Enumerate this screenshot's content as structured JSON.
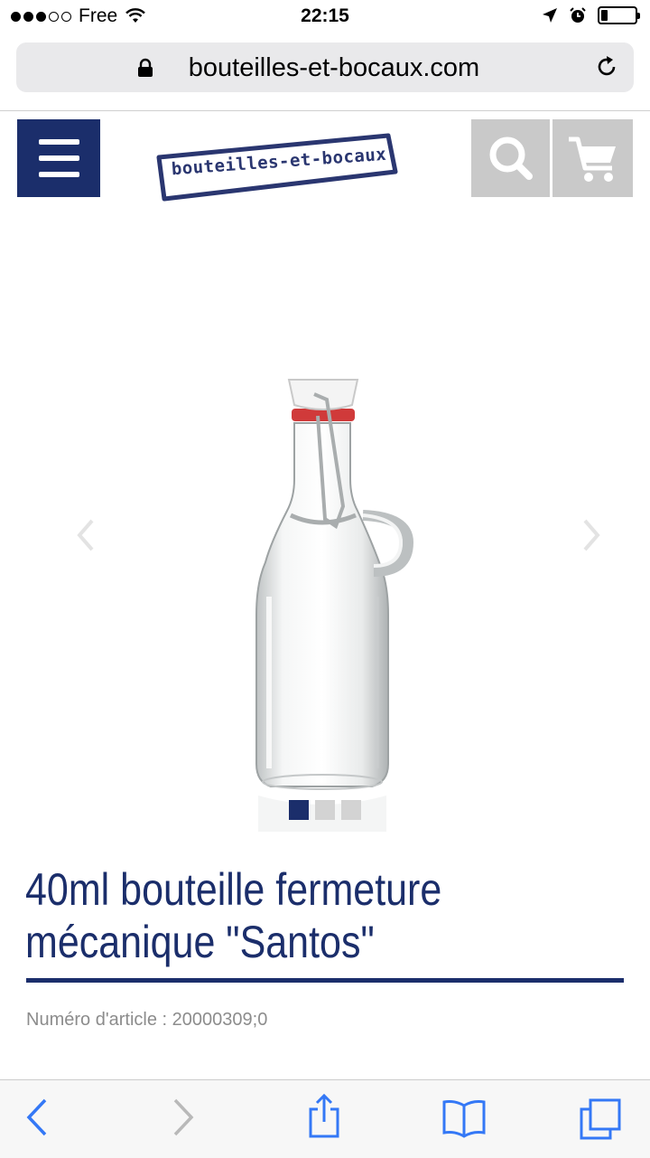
{
  "status_bar": {
    "carrier": "Free",
    "time": "22:15"
  },
  "browser": {
    "url": "bouteilles-et-bocaux.com"
  },
  "site": {
    "logo_text": "bouteilles-et-bocaux",
    "brand_color": "#1b2e6b"
  },
  "gallery": {
    "image_count": 3,
    "active_index": 1
  },
  "product": {
    "title_line1": "40ml bouteille fermeture",
    "title_line2": "mécanique \"Santos\"",
    "article_number": "Numéro d'article : 20000309;0"
  },
  "toolbar": {
    "icons": [
      "back-icon",
      "forward-icon",
      "share-icon",
      "bookmarks-icon",
      "tabs-icon"
    ],
    "accent_color": "#3478f6"
  }
}
